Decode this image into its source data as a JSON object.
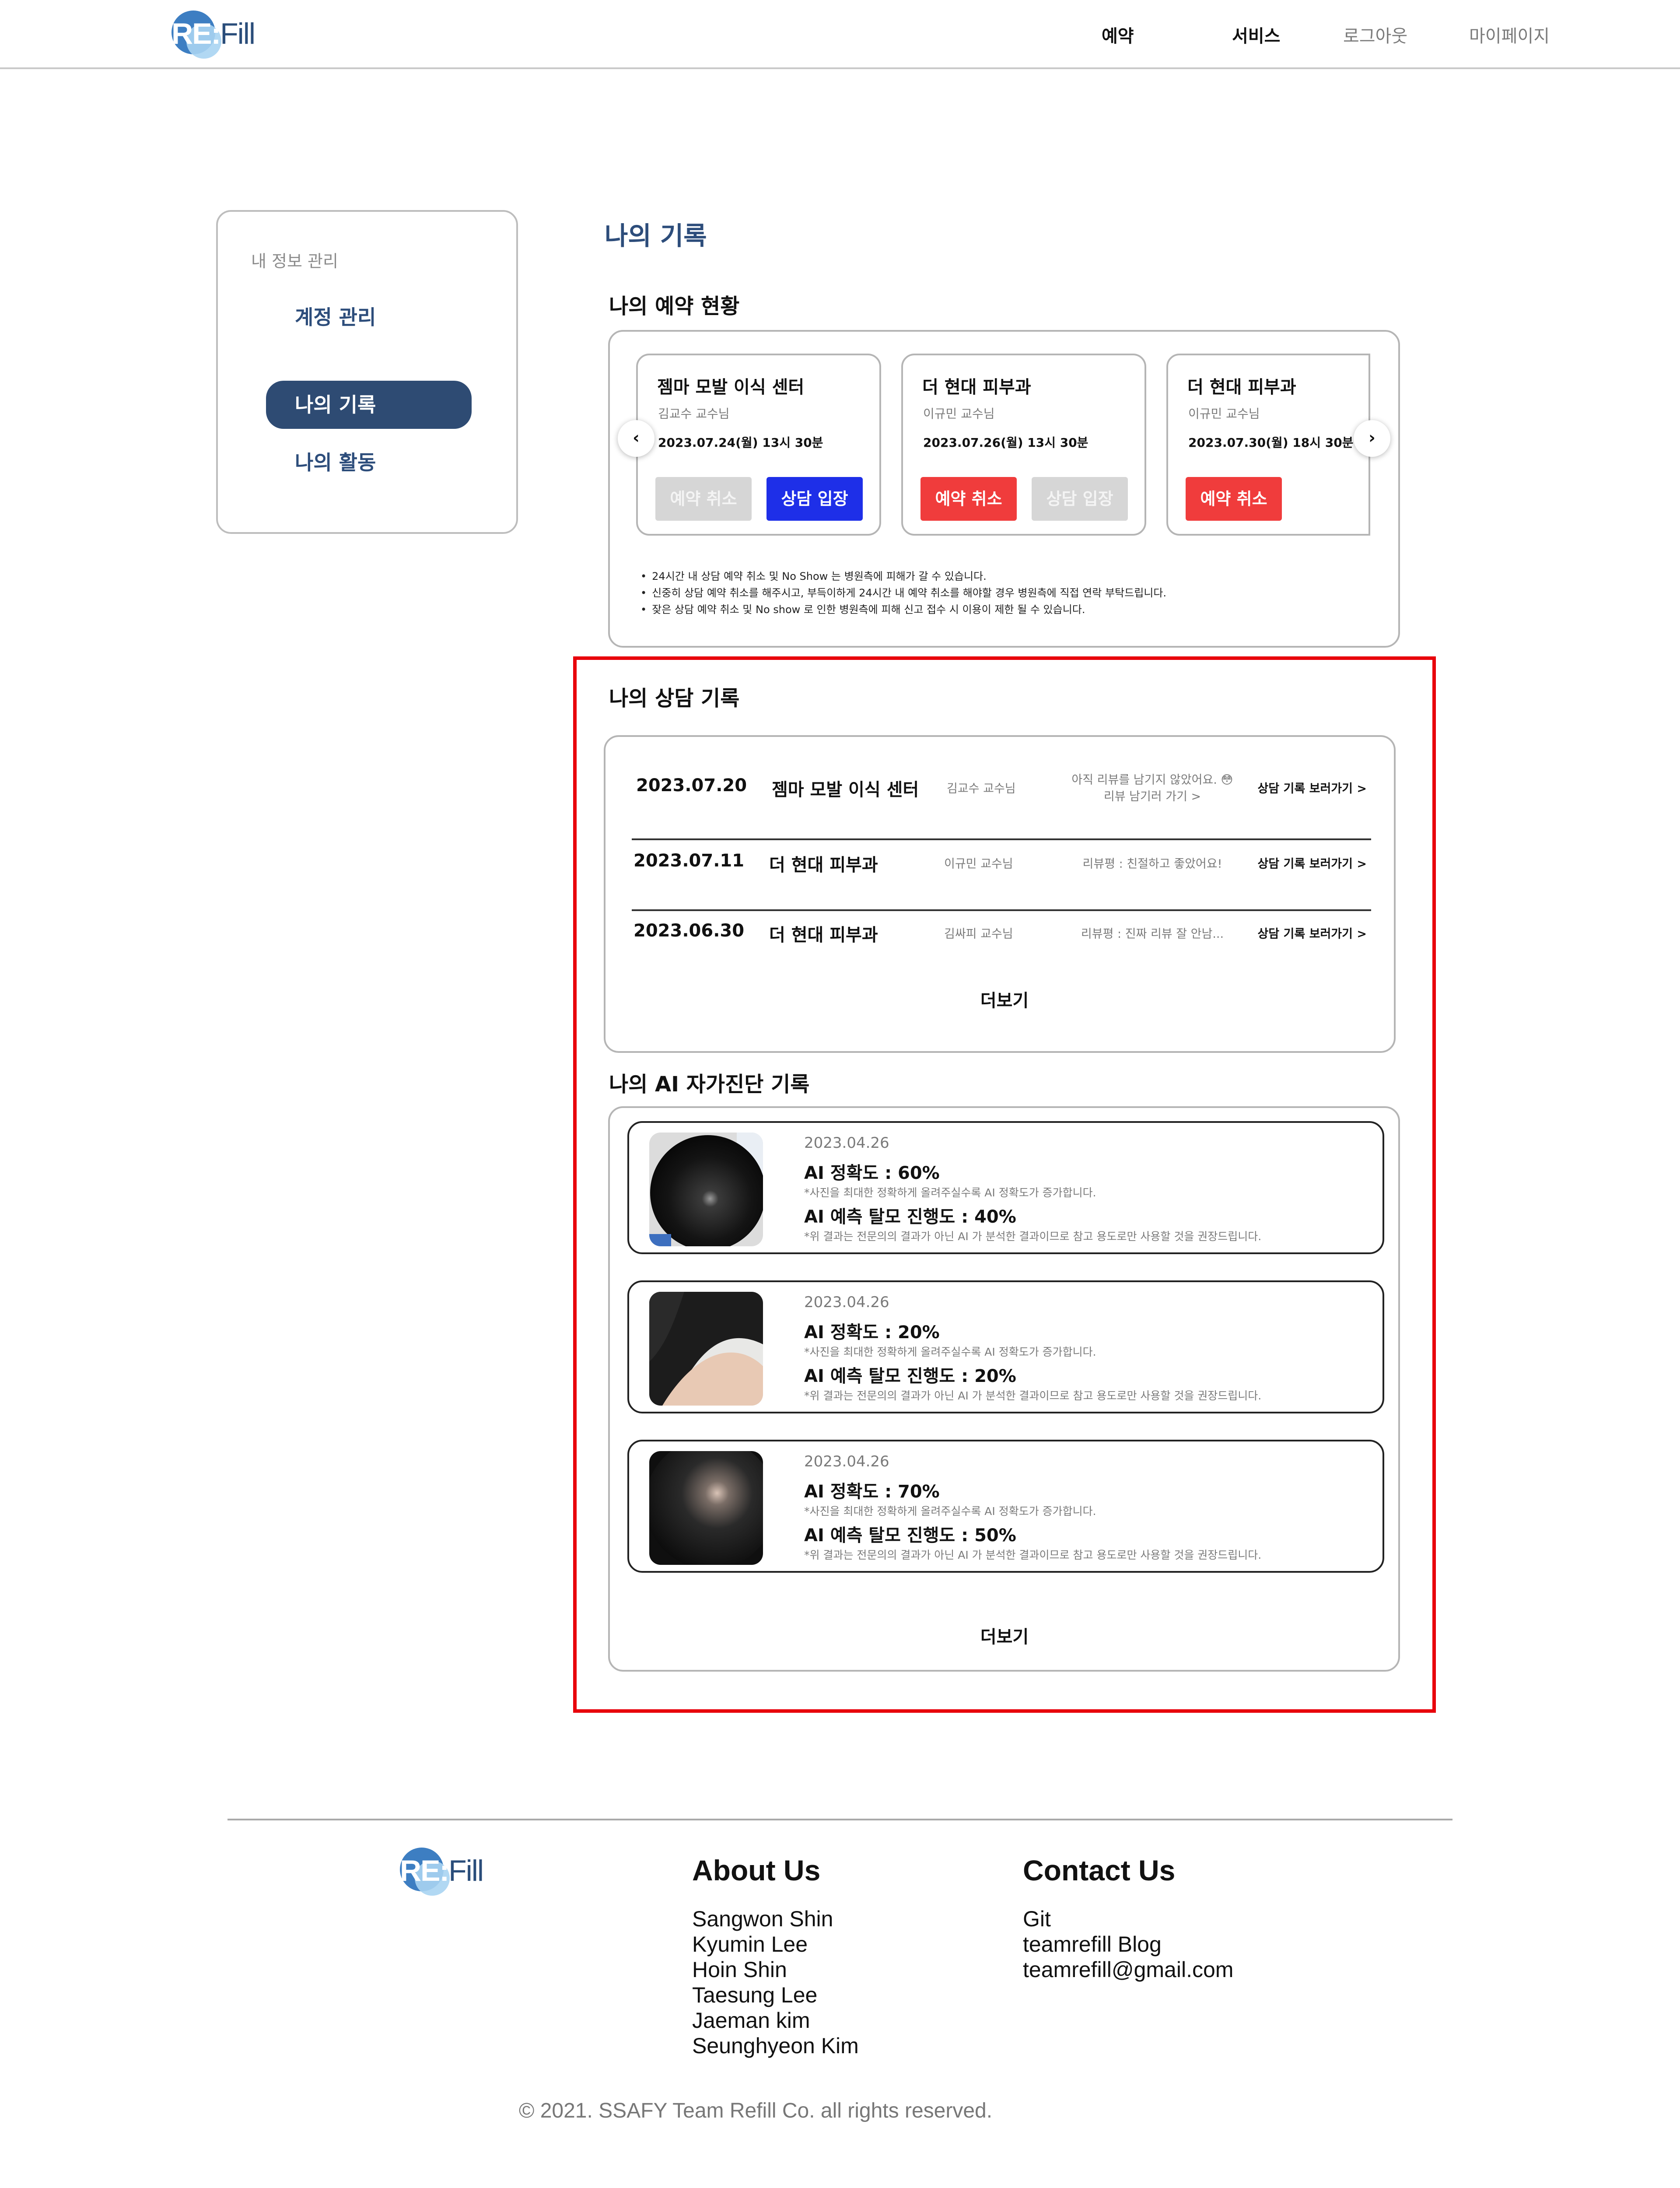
{
  "header": {
    "logo_re": "RE:",
    "logo_fill": "Fill",
    "nav": {
      "reserve": "예약",
      "service": "서비스",
      "logout": "로그아웃",
      "mypage": "마이페이지"
    }
  },
  "sidebar": {
    "heading": "내 정보 관리",
    "items": [
      {
        "label": "계정 관리"
      },
      {
        "label": "나의 기록"
      },
      {
        "label": "나의 활동"
      }
    ]
  },
  "main": {
    "page_title": "나의 기록",
    "reservations": {
      "title": "나의 예약 현황",
      "cards": [
        {
          "clinic": "젬마 모발 이식 센터",
          "doctor": "김교수 교수님",
          "datetime": "2023.07.24(월) 13시 30분",
          "buttons": [
            "예약 취소",
            "상담 입장"
          ]
        },
        {
          "clinic": "더 현대 피부과",
          "doctor": "이규민 교수님",
          "datetime": "2023.07.26(월) 13시 30분",
          "buttons": [
            "예약 취소",
            "상담 입장"
          ]
        },
        {
          "clinic": "더 현대 피부과",
          "doctor": "이규민 교수님",
          "datetime": "2023.07.30(월) 18시 30분",
          "buttons": [
            "예약 취소"
          ]
        }
      ],
      "prev_arrow": "‹",
      "next_arrow": "›",
      "notes": [
        "24시간 내 상담 예약 취소 및 No Show 는 병원측에 피해가 갈 수 있습니다.",
        "신중히 상담 예약 취소를 해주시고, 부득이하게 24시간 내 예약 취소를 해야할 경우 병원측에  직접 연락 부탁드립니다.",
        "잦은 상담 예약 취소 및 No show 로 인한 병원측에 피해 신고 접수 시 이용이 제한 될 수 있습니다."
      ]
    },
    "consultations": {
      "title": "나의 상담 기록",
      "rows": [
        {
          "date": "2023.07.20",
          "clinic": "젬마 모발 이식 센터",
          "doctor": "김교수 교수님",
          "review_line1": "아직 리뷰를 남기지 않았어요. 😳",
          "review_line2": "리뷰 남기러 가기 >",
          "link": "상담 기록 보러가기 >"
        },
        {
          "date": "2023.07.11",
          "clinic": "더 현대 피부과",
          "doctor": "이규민 교수님",
          "review_line1": "리뷰평 : 친절하고 좋았어요!",
          "link": "상담 기록 보러가기 >"
        },
        {
          "date": "2023.06.30",
          "clinic": "더 현대 피부과",
          "doctor": "김싸피 교수님",
          "review_line1": "리뷰평 : 진짜 리뷰 잘 안남...",
          "link": "상담 기록 보러가기 >"
        }
      ],
      "more": "더보기"
    },
    "ai": {
      "title": "나의 AI 자가진단 기록",
      "cards": [
        {
          "date": "2023.04.26",
          "accuracy": "AI 정확도 : 60%",
          "accuracy_note": "*사진을 최대한 정확하게 올려주실수록 AI 정확도가 증가합니다.",
          "progress": "AI 예측 탈모 진행도 : 40%",
          "progress_note": "*위 결과는 전문의의 결과가 아닌 AI 가 분석한 결과이므로 참고 용도로만 사용할 것을 권장드립니다."
        },
        {
          "date": "2023.04.26",
          "accuracy": "AI 정확도 : 20%",
          "accuracy_note": "*사진을 최대한 정확하게 올려주실수록 AI 정확도가 증가합니다.",
          "progress": "AI 예측 탈모 진행도 : 20%",
          "progress_note": "*위 결과는 전문의의 결과가 아닌 AI 가 분석한 결과이므로 참고 용도로만 사용할 것을 권장드립니다."
        },
        {
          "date": "2023.04.26",
          "accuracy": "AI 정확도 : 70%",
          "accuracy_note": "*사진을 최대한 정확하게 올려주실수록 AI 정확도가 증가합니다.",
          "progress": "AI 예측 탈모 진행도 : 50%",
          "progress_note": "*위 결과는 전문의의 결과가 아닌 AI 가 분석한 결과이므로 참고 용도로만 사용할 것을 권장드립니다."
        }
      ],
      "more": "더보기"
    }
  },
  "footer": {
    "about_title": "About Us",
    "about": [
      "Sangwon Shin",
      "Kyumin Lee",
      "Hoin Shin",
      "Taesung Lee",
      "Jaeman kim",
      "Seunghyeon Kim"
    ],
    "contact_title": "Contact Us",
    "contact": [
      "Git",
      "teamrefill Blog",
      "teamrefill@gmail.com"
    ],
    "copyright": "© 2021. SSAFY Team Refill Co. all rights reserved."
  },
  "colors": {
    "brand_navy": "#2e4b73",
    "cancel_red": "#f03c3c",
    "enter_blue": "#1e2fe8",
    "highlight_red": "#e8000b"
  }
}
